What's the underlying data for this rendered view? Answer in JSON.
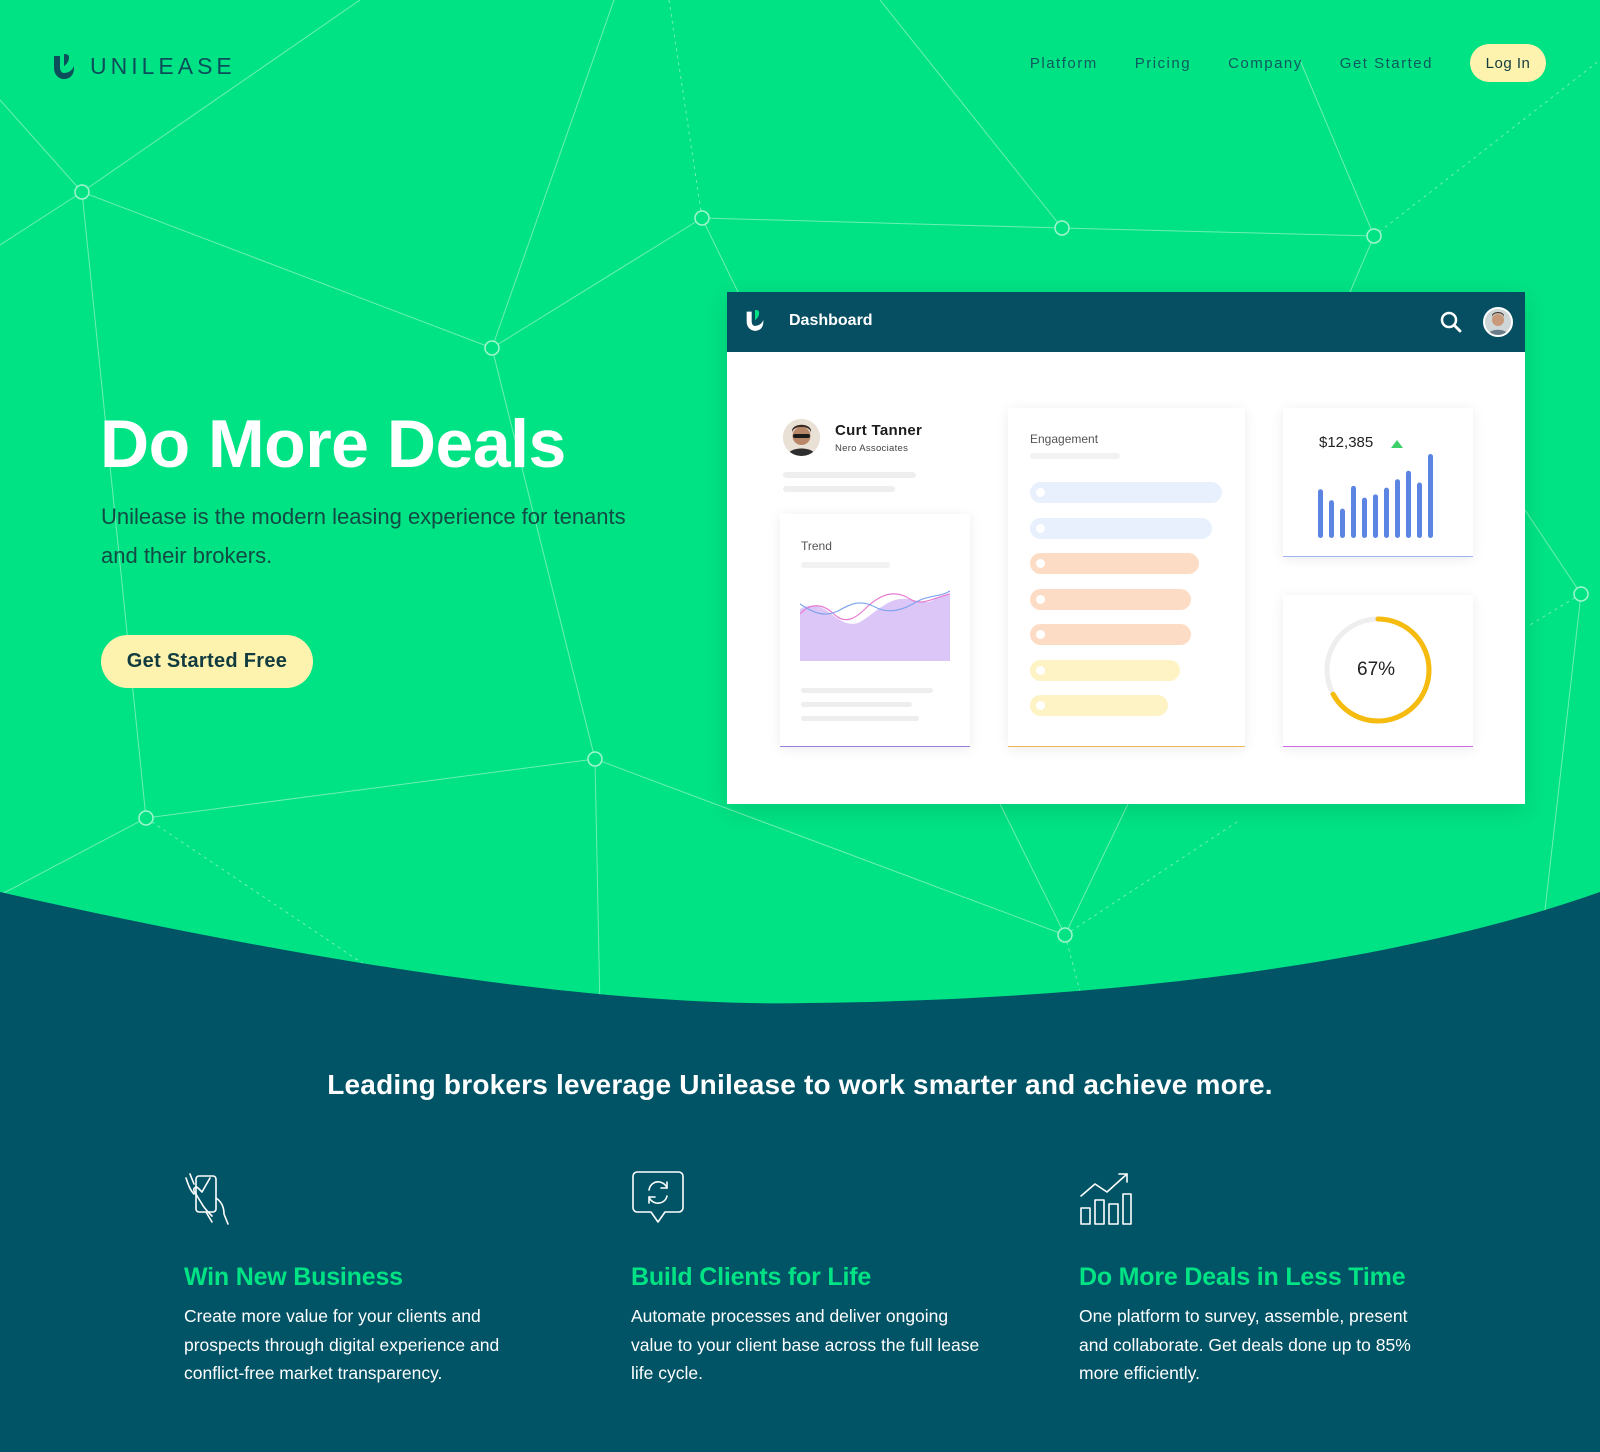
{
  "header": {
    "brand": "UNILEASE",
    "nav": [
      "Platform",
      "Pricing",
      "Company",
      "Get Started"
    ],
    "login_label": "Log In"
  },
  "hero": {
    "title": "Do More Deals",
    "subtitle": "Unilease is the modern leasing experience for tenants and their brokers.",
    "cta_label": "Get Started Free"
  },
  "dashboard": {
    "title": "Dashboard",
    "user": {
      "name": "Curt Tanner",
      "company": "Nero Associates"
    },
    "trend_label": "Trend",
    "engagement_label": "Engagement",
    "revenue": "$12,385",
    "progress": "67%",
    "progress_value": 0.67,
    "bar_values": [
      0.58,
      0.45,
      0.35,
      0.62,
      0.48,
      0.52,
      0.6,
      0.7,
      0.8,
      0.66,
      1.0
    ],
    "engagement_bars": [
      {
        "width": 1.0,
        "color": "#e8f0fd"
      },
      {
        "width": 0.95,
        "color": "#e8f0fd"
      },
      {
        "width": 0.88,
        "color": "#fddcc6"
      },
      {
        "width": 0.84,
        "color": "#fddcc6"
      },
      {
        "width": 0.84,
        "color": "#fddcc6"
      },
      {
        "width": 0.78,
        "color": "#fef3c4"
      },
      {
        "width": 0.72,
        "color": "#fef3c4"
      }
    ],
    "colors": {
      "bar": "#5b84e3",
      "arrow": "#3ccf6a",
      "ring": "#f5bb0e",
      "header": "#064f62"
    }
  },
  "tagline": "Leading brokers leverage Unilease to work smarter and achieve more.",
  "features": [
    {
      "icon": "hand-phone-icon",
      "title": "Win New Business",
      "description": "Create more value for your clients and prospects through digital experience and conflict-free market transparency."
    },
    {
      "icon": "chat-refresh-icon",
      "title": "Build Clients for Life",
      "description": "Automate processes and deliver ongoing value to your client base across the full lease life cycle."
    },
    {
      "icon": "growth-chart-icon",
      "title": "Do More Deals in Less Time",
      "description": "One platform to survey, assemble, present and collaborate.  Get deals done up to 85% more efficiently."
    }
  ],
  "colors": {
    "hero": "#00e384",
    "dark": "#015366",
    "accent": "#fdf2ae"
  }
}
